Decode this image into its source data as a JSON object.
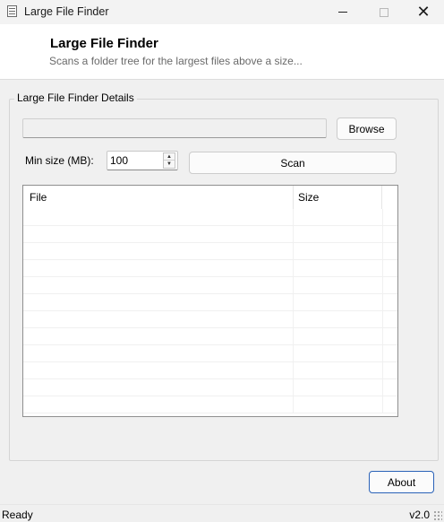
{
  "window": {
    "title": "Large File Finder",
    "close_glyph": "✕"
  },
  "header": {
    "title": "Large File Finder",
    "subtitle": "Scans a folder tree for the largest files above a size..."
  },
  "details": {
    "legend": "Large File Finder Details",
    "path_value": "",
    "browse_label": "Browse",
    "min_size_label": "Min size (MB):",
    "min_size_value": "100",
    "scan_label": "Scan"
  },
  "results": {
    "columns": [
      "File",
      "Size"
    ],
    "rows": []
  },
  "footer": {
    "about_label": "About",
    "status": "Ready",
    "version": "v2.0"
  },
  "icons": {
    "app": "document-icon",
    "minimize": "minimize-icon",
    "maximize": "maximize-icon",
    "close": "close-icon",
    "spin_up": "chevron-up-icon",
    "spin_down": "chevron-down-icon"
  },
  "colors": {
    "accent_border": "#2a62b8",
    "window_bg": "#f0f0f0"
  }
}
